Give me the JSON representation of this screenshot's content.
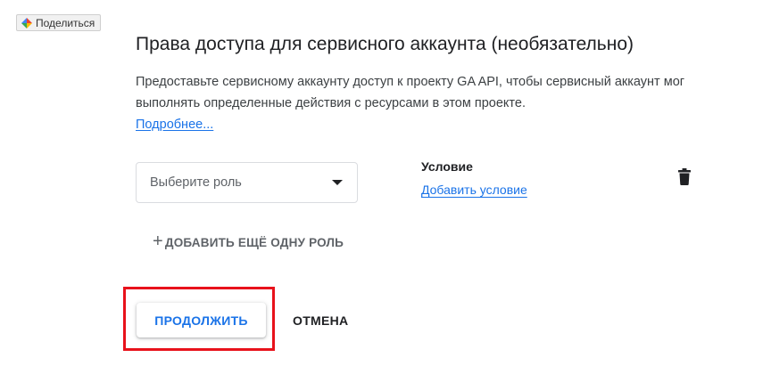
{
  "share_button": {
    "label": "Поделиться",
    "icon": "colorful-diamond-icon"
  },
  "section": {
    "title": "Права доступа для сервисного аккаунта (необязательно)",
    "description": "Предоставьте сервисному аккаунту доступ к проекту GA API, чтобы сервисный аккаунт мог выполнять определенные действия с ресурсами в этом проекте.",
    "learn_more_link": "Подробнее..."
  },
  "role_row": {
    "role_select": {
      "placeholder": "Выберите роль",
      "icon": "dropdown-arrow-icon"
    },
    "condition": {
      "label": "Условие",
      "add_link": "Добавить условие"
    },
    "delete_icon": "trash-icon"
  },
  "add_role_button": {
    "icon": "plus-icon",
    "label": "ДОБАВИТЬ ЕЩЁ ОДНУ РОЛЬ"
  },
  "actions": {
    "continue_label": "ПРОДОЛЖИТЬ",
    "cancel_label": "ОТМЕНА"
  },
  "colors": {
    "accent": "#1a73e8",
    "highlight": "#e8121b",
    "text": "#202124",
    "muted": "#5f6368"
  }
}
